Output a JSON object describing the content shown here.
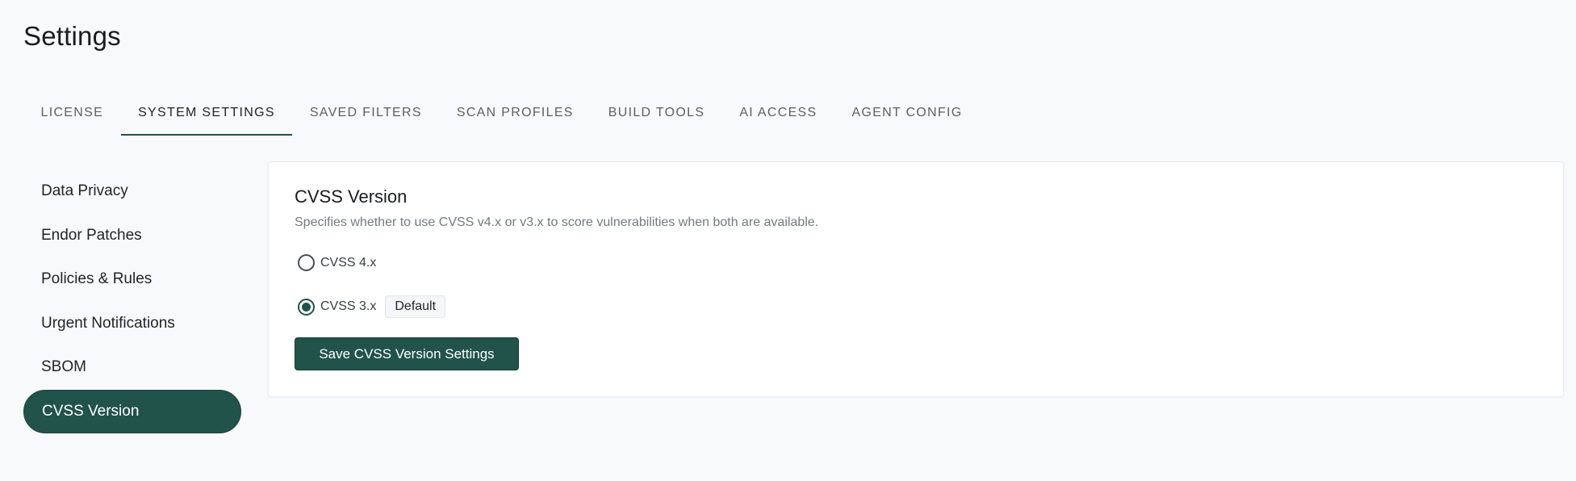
{
  "page": {
    "title": "Settings"
  },
  "tabs": [
    {
      "label": "LICENSE",
      "active": false
    },
    {
      "label": "SYSTEM SETTINGS",
      "active": true
    },
    {
      "label": "SAVED FILTERS",
      "active": false
    },
    {
      "label": "SCAN PROFILES",
      "active": false
    },
    {
      "label": "BUILD TOOLS",
      "active": false
    },
    {
      "label": "AI ACCESS",
      "active": false
    },
    {
      "label": "AGENT CONFIG",
      "active": false
    }
  ],
  "sidebar": {
    "items": [
      {
        "label": "Data Privacy",
        "active": false
      },
      {
        "label": "Endor Patches",
        "active": false
      },
      {
        "label": "Policies & Rules",
        "active": false
      },
      {
        "label": "Urgent Notifications",
        "active": false
      },
      {
        "label": "SBOM",
        "active": false
      },
      {
        "label": "CVSS Version",
        "active": true
      }
    ]
  },
  "card": {
    "title": "CVSS Version",
    "description": "Specifies whether to use CVSS v4.x or v3.x to score vulnerabilities when both are available.",
    "options": [
      {
        "label": "CVSS 4.x",
        "checked": false,
        "badge": null
      },
      {
        "label": "CVSS 3.x",
        "checked": true,
        "badge": "Default"
      }
    ],
    "save_label": "Save CVSS Version Settings"
  },
  "colors": {
    "accent": "#21534b",
    "background": "#f8f9fa",
    "card_background": "#ffffff",
    "muted_text": "#737a80"
  }
}
